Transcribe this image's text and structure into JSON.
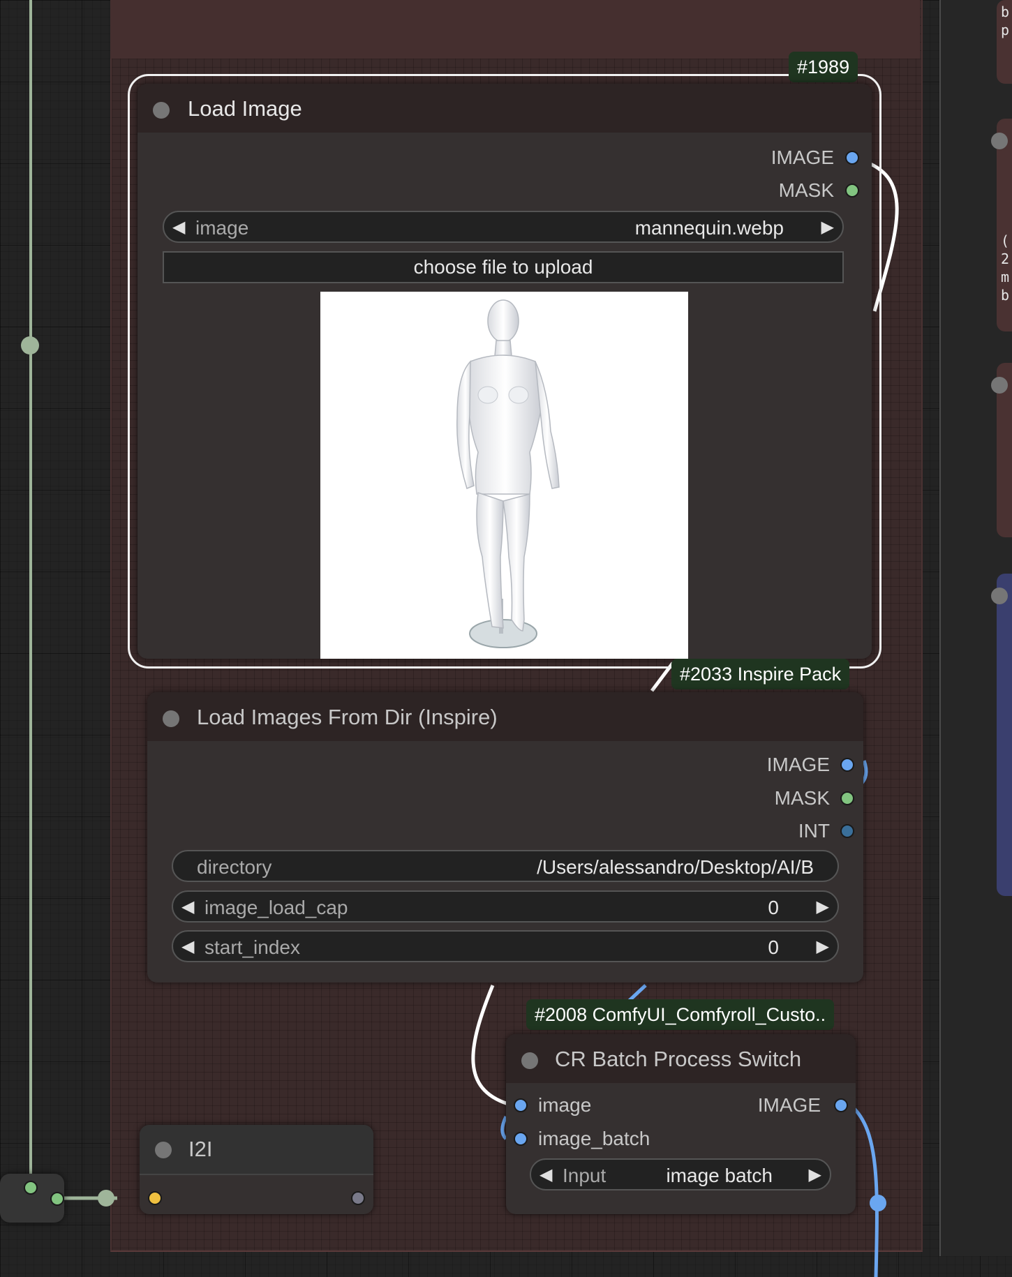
{
  "load_image": {
    "badge": "#1989",
    "title": "Load Image",
    "outputs": [
      "IMAGE",
      "MASK"
    ],
    "widget_image": {
      "name": "image",
      "value": "mannequin.webp"
    },
    "upload_button": "choose file to upload"
  },
  "load_dir": {
    "badge": "#2033 Inspire Pack",
    "title": "Load Images From Dir (Inspire)",
    "outputs": [
      "IMAGE",
      "MASK",
      "INT"
    ],
    "widgets": [
      {
        "name": "directory",
        "value": "/Users/alessandro/Desktop/AI/B"
      },
      {
        "name": "image_load_cap",
        "value": "0"
      },
      {
        "name": "start_index",
        "value": "0"
      }
    ]
  },
  "cr_switch": {
    "badge": "#2008 ComfyUI_Comfyroll_Custo..",
    "title": "CR Batch Process Switch",
    "inputs": [
      "image",
      "image_batch"
    ],
    "output": "IMAGE",
    "widget": {
      "name": "Input",
      "value": "image batch"
    }
  },
  "i2i": {
    "title": "I2I"
  },
  "right_panel_text": [
    "b",
    "p",
    "(",
    "2",
    "m",
    "b"
  ],
  "colors": {
    "image_slot": "#6aa6f0",
    "mask_slot": "#82c480",
    "int_slot": "#3a6f9a",
    "group_bg": "#3a2a2a",
    "badge_bg": "#1f3520"
  }
}
